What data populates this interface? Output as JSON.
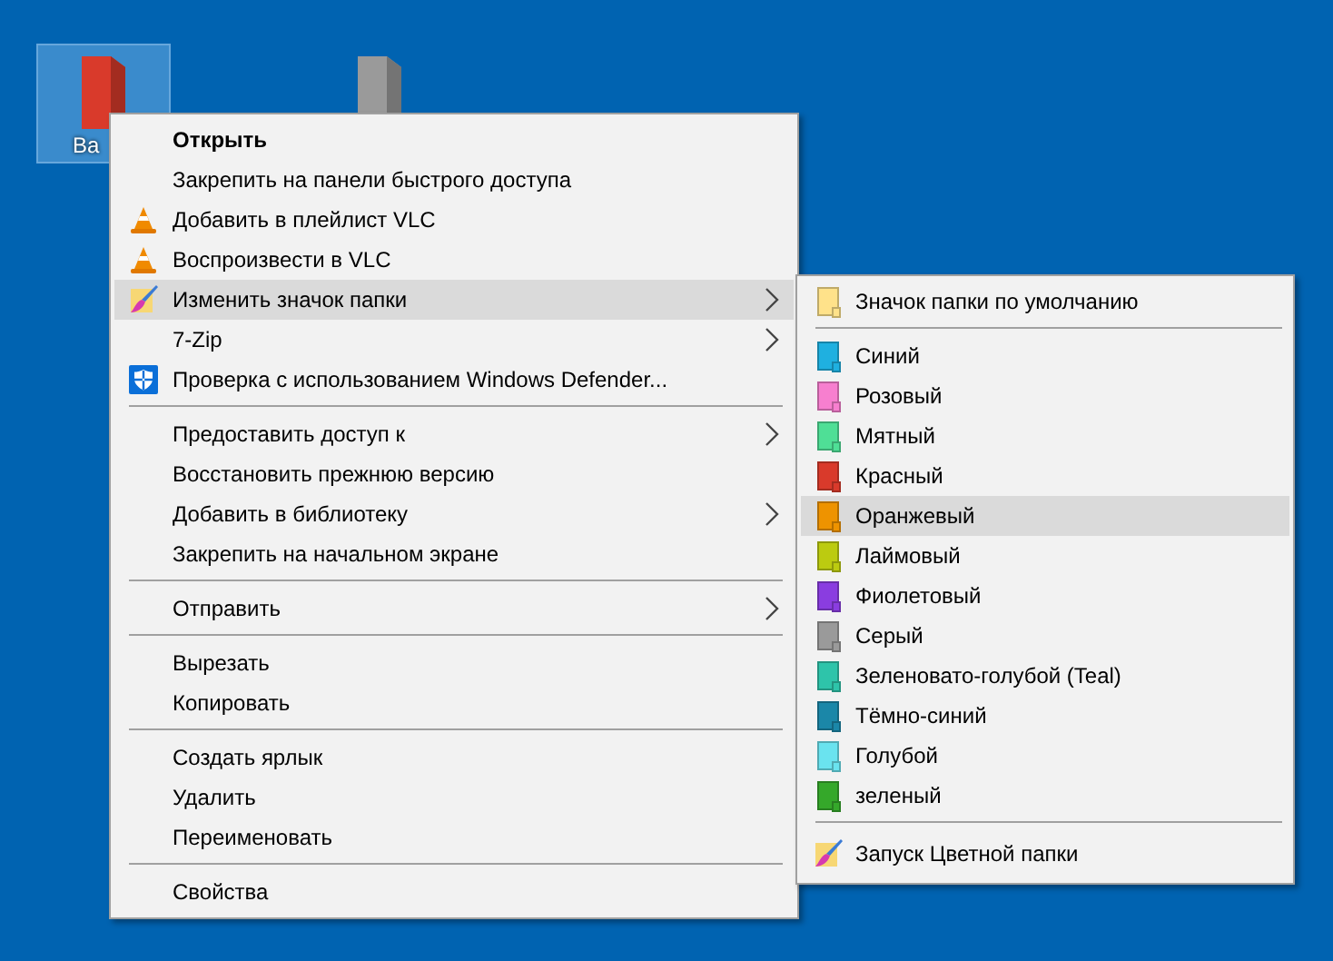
{
  "desktop_icons": [
    {
      "label": "Ва",
      "color": "#d93a2b",
      "selected": true
    },
    {
      "color": "#9a9a9a",
      "selected": false
    }
  ],
  "context_menu": {
    "items": [
      {
        "kind": "item",
        "label": "Открыть",
        "bold": true,
        "submenu": false,
        "selected": false
      },
      {
        "kind": "item",
        "label": "Закрепить на панели быстрого доступа",
        "bold": false,
        "submenu": false,
        "selected": false
      },
      {
        "kind": "vlc",
        "label": "Добавить в плейлист VLC",
        "bold": false,
        "submenu": false,
        "selected": false
      },
      {
        "kind": "vlc",
        "label": "Воспроизвести в VLC",
        "bold": false,
        "submenu": false,
        "selected": false
      },
      {
        "kind": "brush",
        "label": "Изменить значок папки",
        "bold": false,
        "submenu": true,
        "selected": true
      },
      {
        "kind": "item",
        "label": "7-Zip",
        "bold": false,
        "submenu": true,
        "selected": false
      },
      {
        "kind": "shield",
        "label": "Проверка с использованием Windows Defender...",
        "bold": false,
        "submenu": false,
        "selected": false
      },
      {
        "kind": "separator"
      },
      {
        "kind": "item",
        "label": "Предоставить доступ к",
        "bold": false,
        "submenu": true,
        "selected": false
      },
      {
        "kind": "item",
        "label": "Восстановить прежнюю версию",
        "bold": false,
        "submenu": false,
        "selected": false
      },
      {
        "kind": "item",
        "label": "Добавить в библиотеку",
        "bold": false,
        "submenu": true,
        "selected": false
      },
      {
        "kind": "item",
        "label": "Закрепить на начальном экране",
        "bold": false,
        "submenu": false,
        "selected": false
      },
      {
        "kind": "separator"
      },
      {
        "kind": "item",
        "label": "Отправить",
        "bold": false,
        "submenu": true,
        "selected": false
      },
      {
        "kind": "separator"
      },
      {
        "kind": "item",
        "label": "Вырезать",
        "bold": false,
        "submenu": false,
        "selected": false
      },
      {
        "kind": "item",
        "label": "Копировать",
        "bold": false,
        "submenu": false,
        "selected": false
      },
      {
        "kind": "separator"
      },
      {
        "kind": "item",
        "label": "Создать ярлык",
        "bold": false,
        "submenu": false,
        "selected": false
      },
      {
        "kind": "item",
        "label": "Удалить",
        "bold": false,
        "submenu": false,
        "selected": false
      },
      {
        "kind": "item",
        "label": "Переименовать",
        "bold": false,
        "submenu": false,
        "selected": false
      },
      {
        "kind": "separator"
      },
      {
        "kind": "item",
        "label": "Свойства",
        "bold": false,
        "submenu": false,
        "selected": false
      }
    ]
  },
  "submenu": {
    "items": [
      {
        "kind": "folder",
        "label": "Значок папки по умолчанию",
        "color": "#ffe28a",
        "selected": false
      },
      {
        "kind": "separator"
      },
      {
        "kind": "folder",
        "label": "Синий",
        "color": "#1fb0e0",
        "selected": false
      },
      {
        "kind": "folder",
        "label": "Розовый",
        "color": "#f77fcf",
        "selected": false
      },
      {
        "kind": "folder",
        "label": "Мятный",
        "color": "#4fdf96",
        "selected": false
      },
      {
        "kind": "folder",
        "label": "Красный",
        "color": "#d93a2b",
        "selected": false
      },
      {
        "kind": "folder",
        "label": "Оранжевый",
        "color": "#ee9300",
        "selected": true
      },
      {
        "kind": "folder",
        "label": "Лаймовый",
        "color": "#bccb10",
        "selected": false
      },
      {
        "kind": "folder",
        "label": "Фиолетовый",
        "color": "#8a3de0",
        "selected": false
      },
      {
        "kind": "folder",
        "label": "Серый",
        "color": "#9a9a9a",
        "selected": false
      },
      {
        "kind": "folder",
        "label": "Зеленовато-голубой (Teal)",
        "color": "#2ec4aa",
        "selected": false
      },
      {
        "kind": "folder",
        "label": "Тёмно-синий",
        "color": "#1b87a8",
        "selected": false
      },
      {
        "kind": "folder",
        "label": "Голубой",
        "color": "#6ae3ef",
        "selected": false
      },
      {
        "kind": "folder",
        "label": "зеленый",
        "color": "#35a82a",
        "selected": false
      },
      {
        "kind": "separator"
      },
      {
        "kind": "launcher",
        "label": "Запуск Цветной папки",
        "selected": false
      }
    ]
  }
}
